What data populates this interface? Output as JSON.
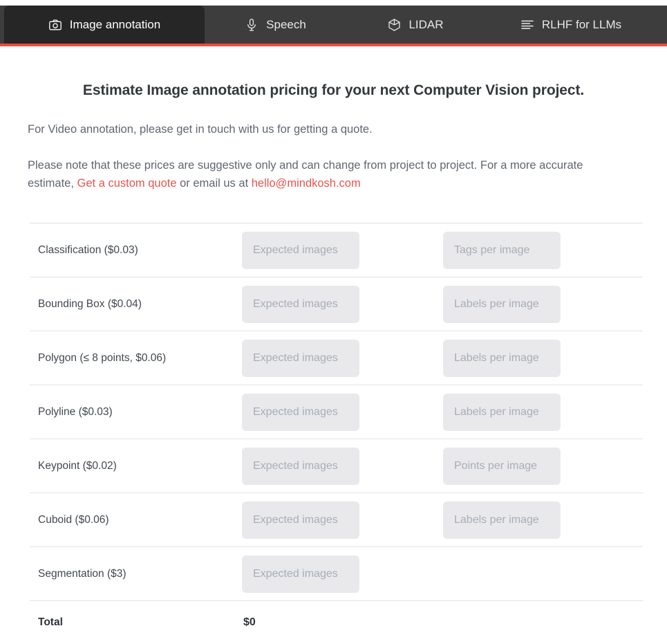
{
  "tabs": [
    {
      "label": "Image annotation",
      "icon": "camera-icon",
      "active": true
    },
    {
      "label": "Speech",
      "icon": "microphone-icon",
      "active": false
    },
    {
      "label": "LIDAR",
      "icon": "cube-icon",
      "active": false
    },
    {
      "label": "RLHF for LLMs",
      "icon": "list-lines-icon",
      "active": false
    }
  ],
  "main": {
    "headline": "Estimate Image annotation pricing for your next Computer Vision project.",
    "video_note": "For Video annotation, please get in touch with us for getting a quote.",
    "disclaimer_part1": "Please note that these prices are suggestive only and can change from project to project. For a more accurate estimate, ",
    "custom_quote_link": "Get a custom quote",
    "disclaimer_part2": " or email us at ",
    "email_link": "hello@mindkosh.com"
  },
  "pricing_table": {
    "rows": [
      {
        "label": "Classification ($0.03)",
        "price": 0.03,
        "images_placeholder": "Expected images",
        "images_value": "",
        "units_placeholder": "Tags per image",
        "units_value": "",
        "has_units": true
      },
      {
        "label": "Bounding Box ($0.04)",
        "price": 0.04,
        "images_placeholder": "Expected images",
        "images_value": "",
        "units_placeholder": "Labels per image",
        "units_value": "",
        "has_units": true
      },
      {
        "label": "Polygon (≤ 8 points, $0.06)",
        "price": 0.06,
        "images_placeholder": "Expected images",
        "images_value": "",
        "units_placeholder": "Labels per image",
        "units_value": "",
        "has_units": true
      },
      {
        "label": "Polyline ($0.03)",
        "price": 0.03,
        "images_placeholder": "Expected images",
        "images_value": "",
        "units_placeholder": "Labels per image",
        "units_value": "",
        "has_units": true
      },
      {
        "label": "Keypoint ($0.02)",
        "price": 0.02,
        "images_placeholder": "Expected images",
        "images_value": "",
        "units_placeholder": "Points per image",
        "units_value": "",
        "has_units": true
      },
      {
        "label": "Cuboid ($0.06)",
        "price": 0.06,
        "images_placeholder": "Expected images",
        "images_value": "",
        "units_placeholder": "Labels per image",
        "units_value": "",
        "has_units": true
      },
      {
        "label": "Segmentation ($3)",
        "price": 3,
        "images_placeholder": "Expected images",
        "images_value": "",
        "units_placeholder": "",
        "units_value": "",
        "has_units": false
      }
    ],
    "total_label": "Total",
    "total_value": "$0"
  },
  "colors": {
    "tabbar_background": "#3d3d3d",
    "active_tab_background": "#262626",
    "accent_rule": "#ef4b42",
    "link": "#e8544a",
    "input_background": "#e9e9eb",
    "placeholder": "#a8adb6",
    "divider": "#dde3e9"
  }
}
